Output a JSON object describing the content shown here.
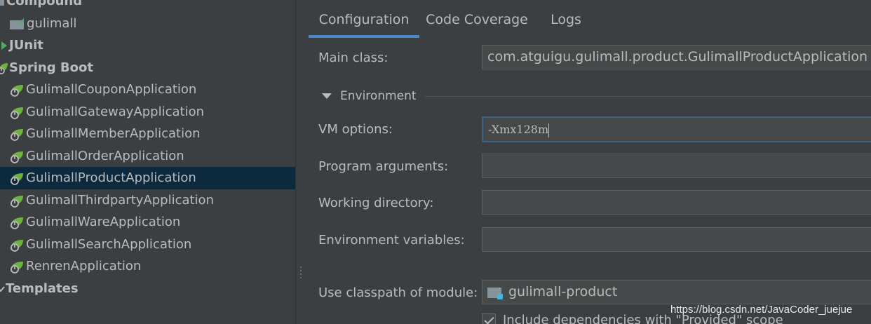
{
  "tree": {
    "items": [
      {
        "label": "Compound",
        "icon": "compound-icon"
      },
      {
        "label": "gulimall",
        "icon": "folder-icon"
      },
      {
        "label": "JUnit",
        "icon": "junit-icon"
      },
      {
        "label": "Spring Boot",
        "icon": "spring-boot-icon"
      },
      {
        "label": "GulimallCouponApplication",
        "icon": "spring-boot-app-icon"
      },
      {
        "label": "GulimallGatewayApplication",
        "icon": "spring-boot-app-icon"
      },
      {
        "label": "GulimallMemberApplication",
        "icon": "spring-boot-app-icon"
      },
      {
        "label": "GulimallOrderApplication",
        "icon": "spring-boot-app-icon"
      },
      {
        "label": "GulimallProductApplication",
        "icon": "spring-boot-app-icon",
        "selected": true
      },
      {
        "label": "GulimallThirdpartyApplication",
        "icon": "spring-boot-app-icon"
      },
      {
        "label": "GulimallWareApplication",
        "icon": "spring-boot-app-icon"
      },
      {
        "label": "GulimallSearchApplication",
        "icon": "spring-boot-app-icon"
      },
      {
        "label": "RenrenApplication",
        "icon": "spring-boot-app-icon"
      },
      {
        "label": "Templates",
        "icon": "templates-icon"
      }
    ]
  },
  "tabs": [
    {
      "label": "Configuration",
      "active": true
    },
    {
      "label": "Code Coverage",
      "active": false
    },
    {
      "label": "Logs",
      "active": false
    }
  ],
  "form": {
    "main_class_label": "Main class:",
    "main_class_value": "com.atguigu.gulimall.product.GulimallProductApplication",
    "environment_label": "Environment",
    "vm_options_label": "VM options:",
    "vm_options_value": "-Xmx128m",
    "program_arguments_label": "Program arguments:",
    "program_arguments_value": "",
    "working_directory_label": "Working directory:",
    "working_directory_value": "",
    "environment_variables_label": "Environment variables:",
    "environment_variables_value": "",
    "classpath_label": "Use classpath of module:",
    "classpath_value": "gulimall-product",
    "include_dependencies_label": "Include dependencies with \"Provided\" scope",
    "include_dependencies_checked": true
  },
  "watermark": "https://blog.csdn.net/JavaCoder_juejue",
  "colors": {
    "background": "#3c3f41",
    "selection": "#0d293e",
    "active_tab_underline": "#4a88c7",
    "spring_green": "#6db33f",
    "text": "#bbbbbb"
  }
}
